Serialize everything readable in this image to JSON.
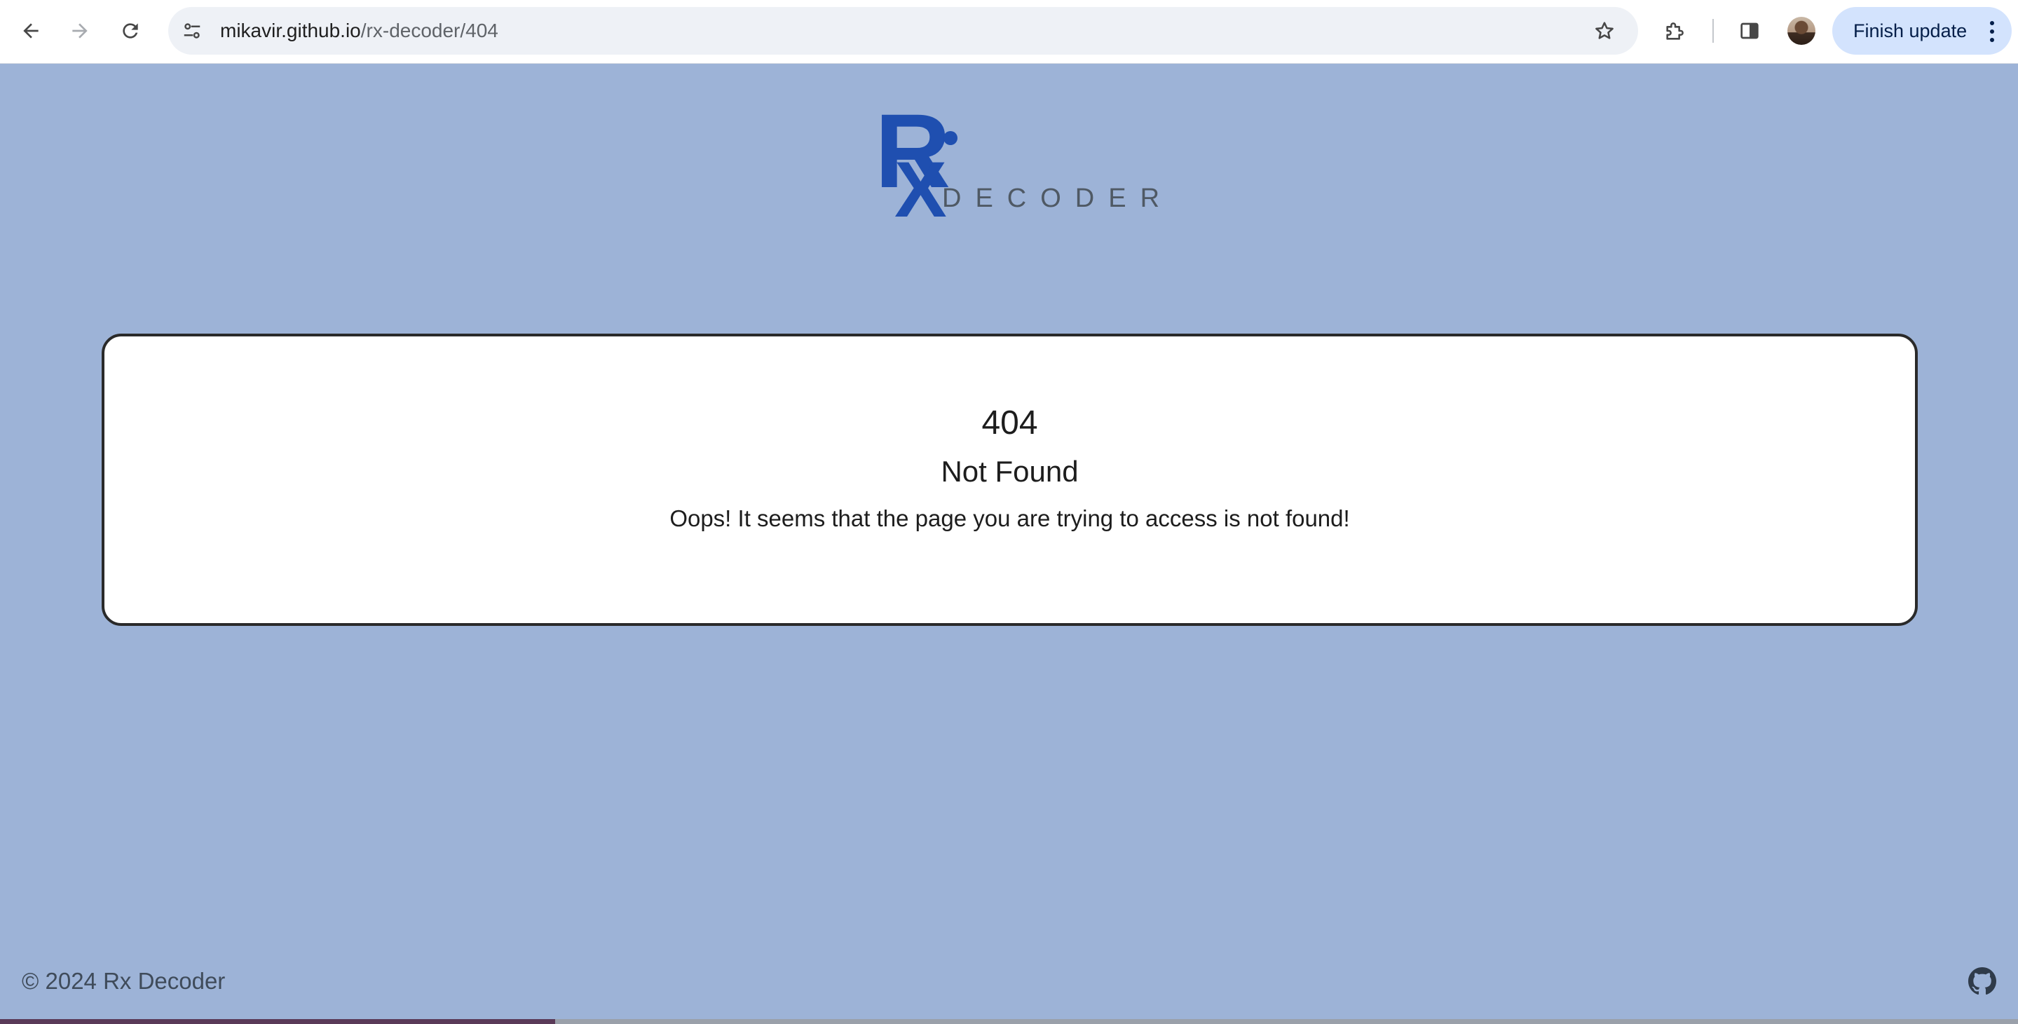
{
  "browser": {
    "url_host": "mikavir.github.io",
    "url_path": "/rx-decoder/404",
    "finish_update_label": "Finish update"
  },
  "logo": {
    "letter_r": "R",
    "letter_x": "X",
    "word": "DECODER",
    "accent_color": "#1f4fb0"
  },
  "error": {
    "code": "404",
    "title": "Not Found",
    "message": "Oops! It seems that the page you are trying to access is not found!"
  },
  "footer": {
    "copyright": "© 2024 Rx Decoder",
    "github_icon": "github-icon"
  },
  "colors": {
    "page_background": "#9db3d7",
    "card_background": "#ffffff",
    "card_border": "#2a2a2a",
    "update_button": "#d3e3fd"
  }
}
